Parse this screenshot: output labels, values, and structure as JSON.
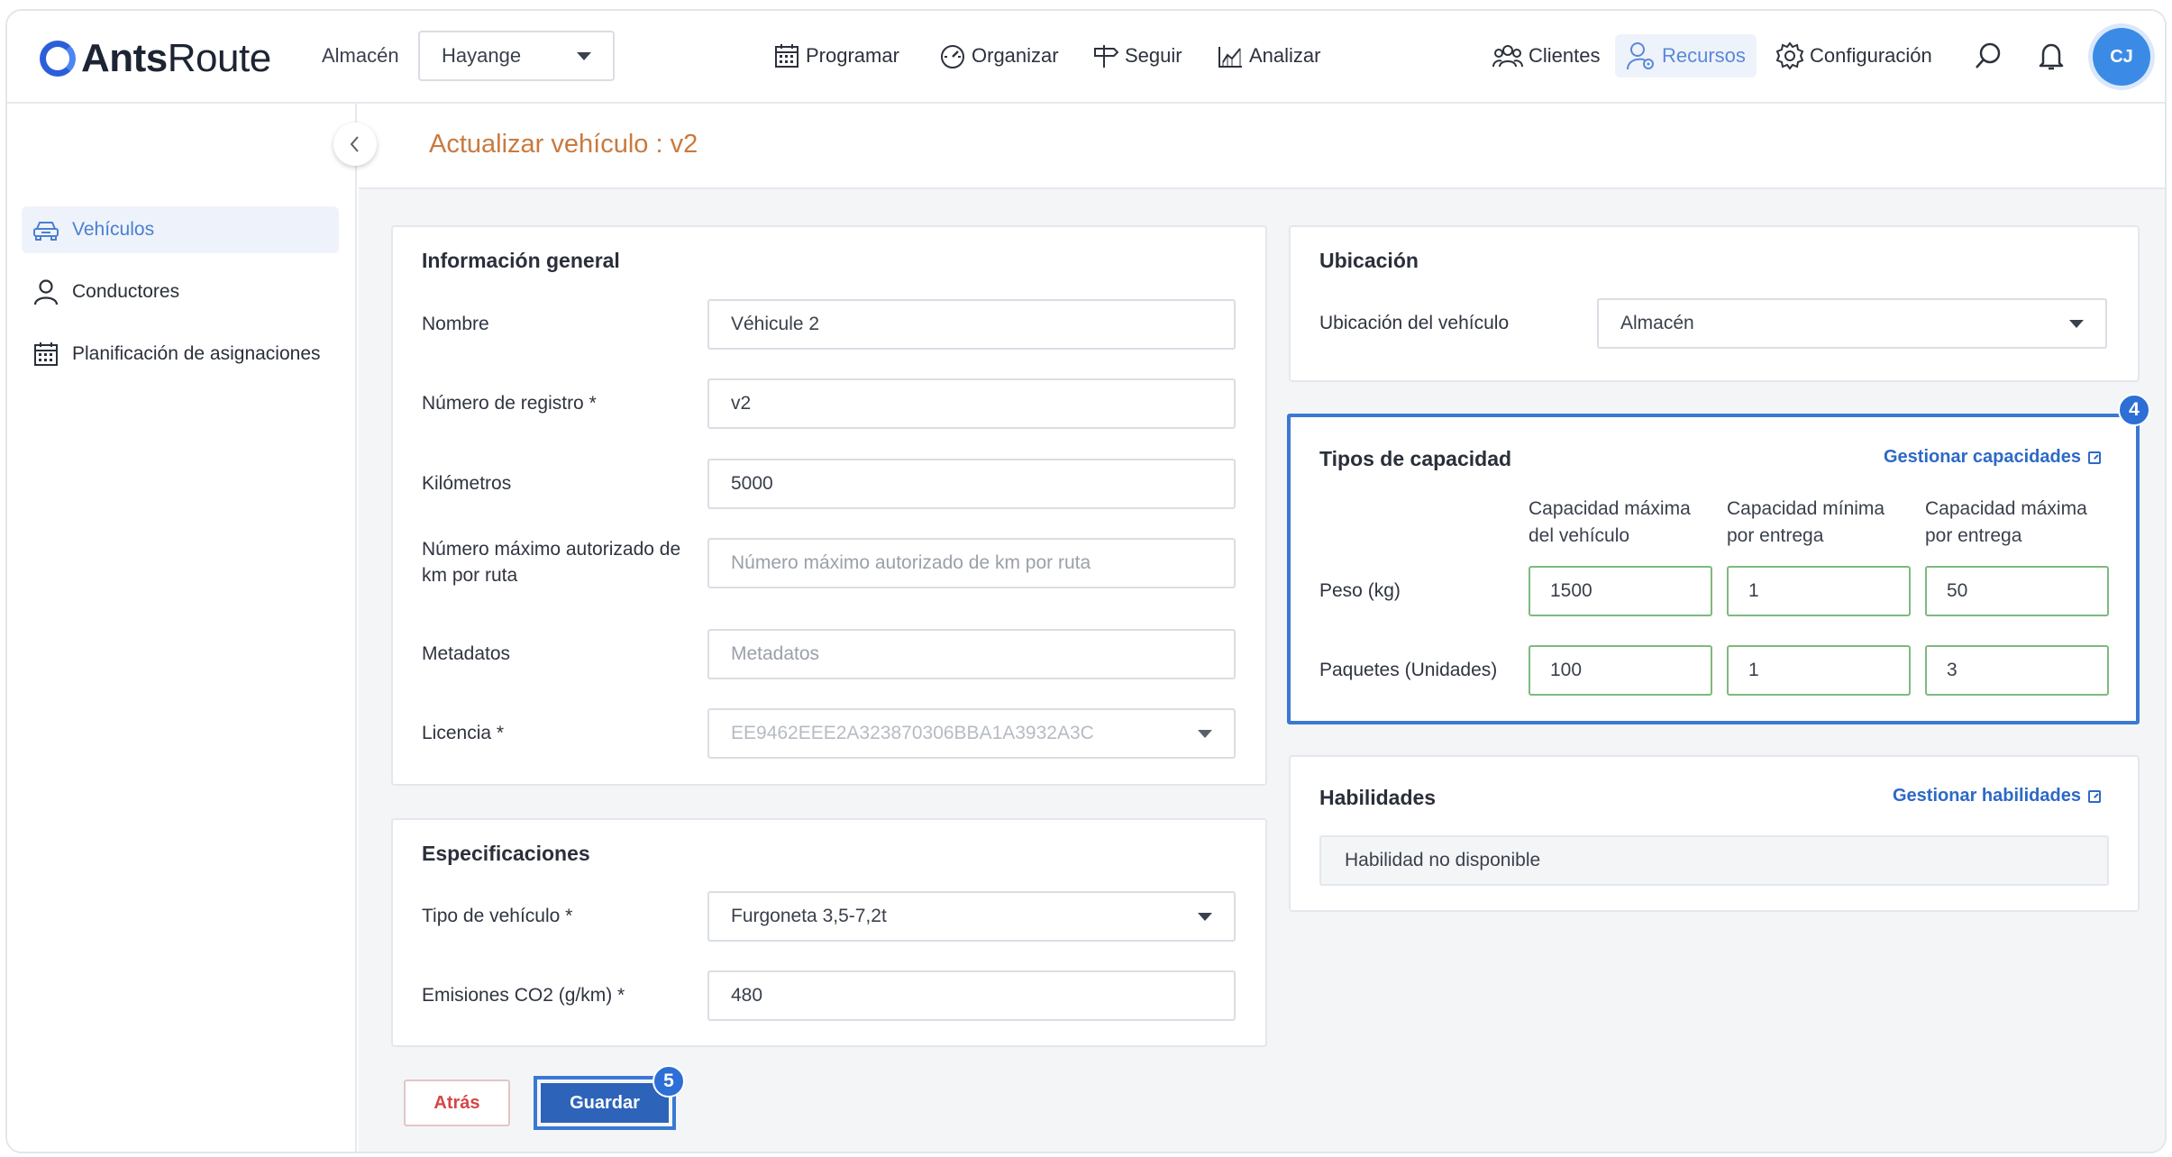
{
  "app": {
    "logo_bold": "Ants",
    "logo_light": "Route"
  },
  "header": {
    "warehouse_label": "Almacén",
    "warehouse_value": "Hayange",
    "nav": [
      {
        "label": "Programar",
        "icon": "calendar-icon"
      },
      {
        "label": "Organizar",
        "icon": "gauge-icon"
      },
      {
        "label": "Seguir",
        "icon": "signpost-icon"
      },
      {
        "label": "Analizar",
        "icon": "chart-icon"
      },
      {
        "label": "Clientes",
        "icon": "group-icon"
      },
      {
        "label": "Recursos",
        "icon": "resources-icon"
      },
      {
        "label": "Configuración",
        "icon": "gear-icon"
      }
    ],
    "avatar_initials": "CJ"
  },
  "sidebar": {
    "items": [
      {
        "label": "Vehículos",
        "icon": "car-icon",
        "active": true
      },
      {
        "label": "Conductores",
        "icon": "person-icon",
        "active": false
      },
      {
        "label": "Planificación de asignaciones",
        "icon": "calendar-icon",
        "active": false
      }
    ]
  },
  "page": {
    "title": "Actualizar vehículo : v2"
  },
  "general": {
    "title": "Información general",
    "fields": [
      {
        "label": "Nombre",
        "value": "Véhicule 2",
        "placeholder": ""
      },
      {
        "label": "Número de registro *",
        "value": "v2",
        "placeholder": ""
      },
      {
        "label": "Kilómetros",
        "value": "5000",
        "placeholder": ""
      },
      {
        "label": "Número máximo autorizado de km por ruta",
        "value": "",
        "placeholder": "Número máximo autorizado de km por ruta"
      },
      {
        "label": "Metadatos",
        "value": "",
        "placeholder": "Metadatos"
      },
      {
        "label": "Licencia *",
        "value": "EE9462EEE2A323870306BBA1A3932A3C",
        "placeholder": ""
      }
    ]
  },
  "specs": {
    "title": "Especificaciones",
    "vehicle_type_label": "Tipo de vehículo *",
    "vehicle_type_value": "Furgoneta 3,5-7,2t",
    "co2_label": "Emisiones CO2 (g/km) *",
    "co2_value": "480"
  },
  "location": {
    "title": "Ubicación",
    "label": "Ubicación del vehículo",
    "value": "Almacén"
  },
  "capacity": {
    "title": "Tipos de capacidad",
    "manage_link": "Gestionar capacidades",
    "columns": [
      "Capacidad máxima del vehículo",
      "Capacidad mínima por entrega",
      "Capacidad máxima por entrega"
    ],
    "rows": [
      {
        "label": "Peso (kg)",
        "values": [
          "1500",
          "1",
          "50"
        ]
      },
      {
        "label": "Paquetes (Unidades)",
        "values": [
          "100",
          "1",
          "3"
        ]
      }
    ],
    "step_badge": "4"
  },
  "skills": {
    "title": "Habilidades",
    "manage_link": "Gestionar habilidades",
    "empty_text": "Habilidad no disponible"
  },
  "actions": {
    "back_label": "Atrás",
    "save_label": "Guardar",
    "step_badge": "5"
  }
}
